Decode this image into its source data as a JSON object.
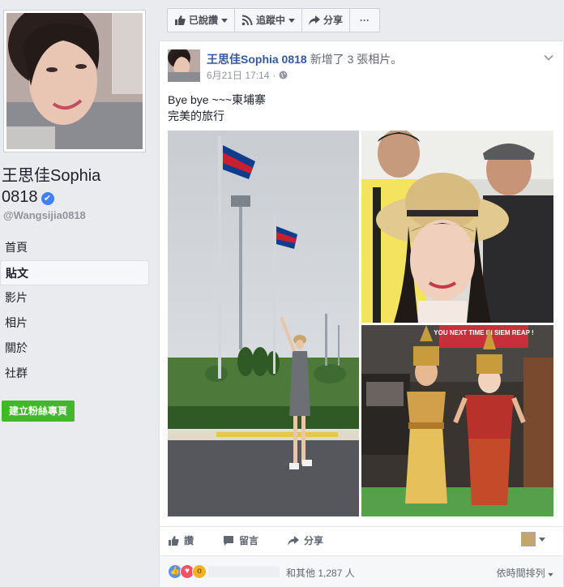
{
  "profile": {
    "name_line1": "王思佳Sophia",
    "name_line2": "0818",
    "verified_mark": "✔",
    "handle": "@Wangsijia0818"
  },
  "nav": {
    "items": [
      {
        "label": "首頁"
      },
      {
        "label": "貼文"
      },
      {
        "label": "影片"
      },
      {
        "label": "相片"
      },
      {
        "label": "關於"
      },
      {
        "label": "社群"
      }
    ],
    "active_index": 1,
    "create_button": "建立粉絲專頁"
  },
  "actionbar": {
    "liked": "已說讚",
    "following": "追蹤中",
    "share": "分享",
    "more": "···"
  },
  "post": {
    "author": "王思佳Sophia 0818",
    "verb": "新增了 3 張相片。",
    "date": "6月21日 17:14",
    "separator": "·",
    "text_line1": "Bye bye ~~~東埔寨",
    "text_line2": "完美的旅行",
    "sign_text": "YOU NEXT TIME IN SIEM REAP !"
  },
  "actions": {
    "like": "讚",
    "comment": "留言",
    "share": "分享"
  },
  "reactions": {
    "count_text": "和其他 1,287 人",
    "sort": "依時間排列"
  },
  "colors": {
    "link": "#365899",
    "green_button": "#42b72a",
    "page_bg": "#e9ebee"
  }
}
